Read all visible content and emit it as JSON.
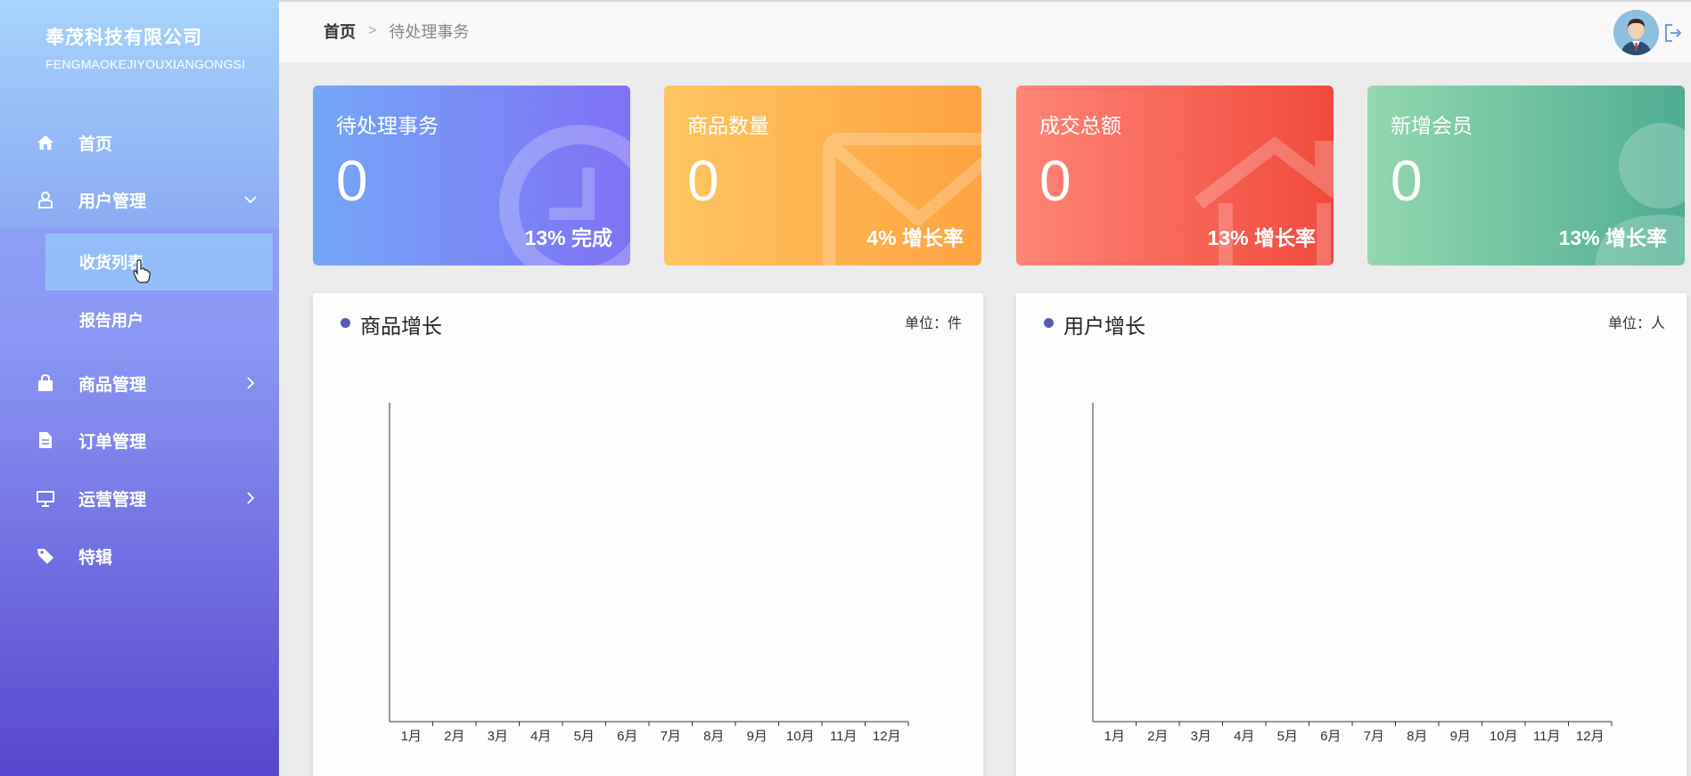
{
  "brand": {
    "name": "奉茂科技有限公司",
    "subtitle": "FENGMAOKEJIYOUXIANGONGSI"
  },
  "sidebar": {
    "items": [
      {
        "label": "首页",
        "icon": "home-icon"
      },
      {
        "label": "用户管理",
        "icon": "user-icon",
        "expanded": true
      },
      {
        "label": "商品管理",
        "icon": "shopping-bag-icon"
      },
      {
        "label": "订单管理",
        "icon": "document-icon"
      },
      {
        "label": "运营管理",
        "icon": "monitor-icon"
      },
      {
        "label": "特辑",
        "icon": "tag-icon"
      }
    ],
    "subitems": [
      {
        "label": "收货列表",
        "active": true
      },
      {
        "label": "报告用户"
      }
    ]
  },
  "header": {
    "breadcrumb_home": "首页",
    "breadcrumb_sep": ">",
    "breadcrumb_current": "待处理事务"
  },
  "cards": [
    {
      "title": "待处理事务",
      "value": "0",
      "percent": "13%",
      "caption": "完成",
      "gradient_from": "#74a6f6",
      "gradient_to": "#8072f7",
      "icon": "clock-icon"
    },
    {
      "title": "商品数量",
      "value": "0",
      "percent": "4%",
      "caption": "增长率",
      "gradient_from": "#fec560",
      "gradient_to": "#fea341",
      "icon": "mail-icon"
    },
    {
      "title": "成交总额",
      "value": "0",
      "percent": "13%",
      "caption": "增长率",
      "gradient_from": "#fe8577",
      "gradient_to": "#f14a3c",
      "icon": "house-icon"
    },
    {
      "title": "新增会员",
      "value": "0",
      "percent": "13%",
      "caption": "增长率",
      "gradient_from": "#94d8b0",
      "gradient_to": "#4fac92",
      "icon": "user-icon"
    }
  ],
  "panels": [
    {
      "title": "商品增长",
      "unit": "单位：件"
    },
    {
      "title": "用户增长",
      "unit": "单位：人"
    }
  ],
  "chart_data": [
    {
      "type": "line",
      "categories": [
        "1月",
        "2月",
        "3月",
        "4月",
        "5月",
        "6月",
        "7月",
        "8月",
        "9月",
        "10月",
        "11月",
        "12月"
      ],
      "series": []
    },
    {
      "type": "line",
      "categories": [
        "1月",
        "2月",
        "3月",
        "4月",
        "5月",
        "6月",
        "7月",
        "8月",
        "9月",
        "10月",
        "11月",
        "12月"
      ],
      "series": []
    }
  ]
}
